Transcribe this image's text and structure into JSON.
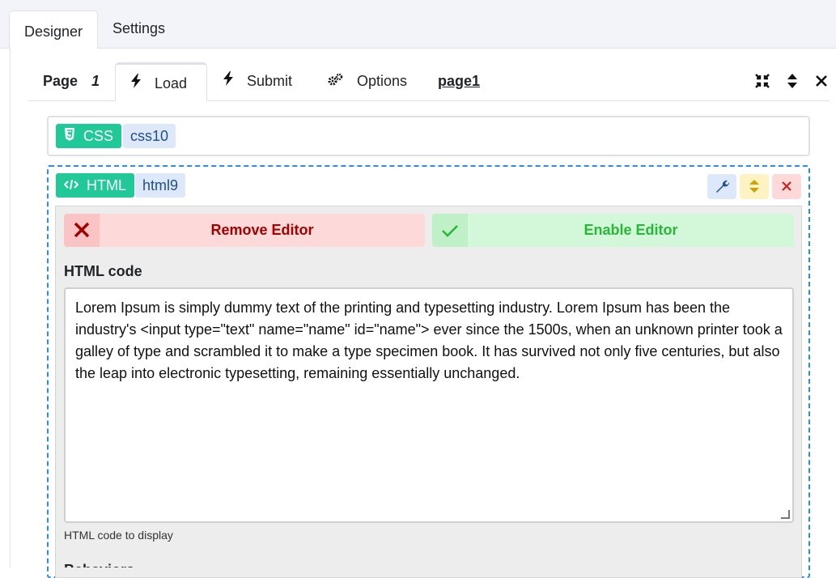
{
  "top_tabs": {
    "designer": "Designer",
    "settings": "Settings"
  },
  "page_tabs": {
    "page_label": "Page",
    "page_number": "1",
    "load": "Load",
    "submit": "Submit",
    "options": "Options",
    "page_name": "page1"
  },
  "css_block": {
    "type_label": "CSS",
    "id": "css10"
  },
  "html_block": {
    "type_label": "HTML",
    "id": "html9",
    "remove_editor": "Remove Editor",
    "enable_editor": "Enable Editor",
    "field_label": "HTML code",
    "code_value": "Lorem Ipsum is simply dummy text of the printing and typesetting industry. Lorem Ipsum has been the industry's <input type=\"text\" name=\"name\" id=\"name\"> ever since the 1500s, when an unknown printer took a galley of type and scrambled it to make a type specimen book. It has survived not only five centuries, but also the leap into electronic typesetting, remaining essentially unchanged.",
    "help_text": "HTML code to display",
    "next_section": "Behaviors"
  },
  "colors": {
    "badge_type": "#20c997",
    "badge_id": "#dde9fa",
    "remove_bg": "#fdd9d9",
    "remove_text": "#a40000",
    "enable_bg": "#d3f7d9",
    "enable_text": "#28b838",
    "selection_border": "#2a8ee8"
  },
  "icons": {
    "load": "bolt-icon",
    "submit": "bolt-icon",
    "options": "gears-icon",
    "compress": "compress-icon",
    "sort": "sort-icon",
    "close": "close-icon",
    "css": "css3-icon",
    "html": "code-icon",
    "wrench": "wrench-icon",
    "move": "sort-icon",
    "delete": "close-icon",
    "remove": "close-icon",
    "enable": "check-icon"
  }
}
